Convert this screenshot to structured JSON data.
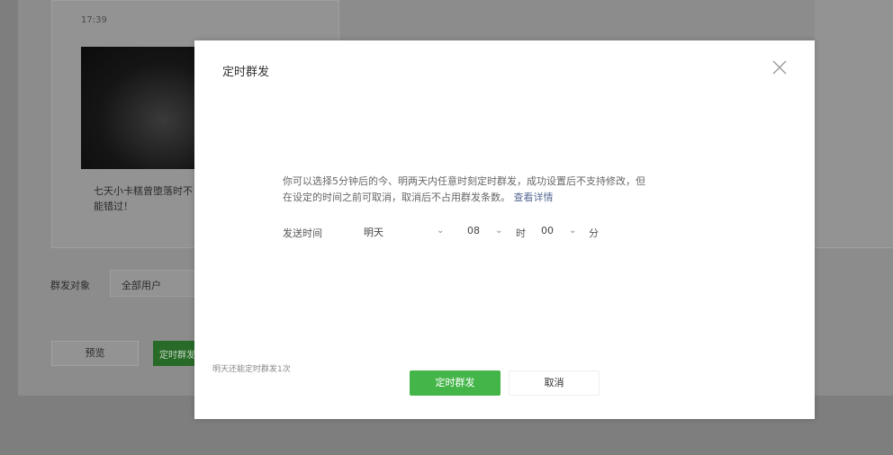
{
  "background": {
    "card_time": "17:39",
    "card_title": "七天小卡糕曾堕落时不能错过！",
    "target_label": "群发对象",
    "target_value": "全部用户",
    "preview_label": "预览",
    "schedule_label": "定时群发"
  },
  "dialog": {
    "title": "定时群发",
    "description_line1": "你可以选择5分钟后的今、明两天内任意时刻定时群发，成功设置后不支持修改，但",
    "description_line2": "在设定的时间之前可取消，取消后不占用群发条数。",
    "detail_link": "查看详情",
    "send_time_label": "发送时间",
    "day_value": "明天",
    "hour_value": "08",
    "hour_unit": "时",
    "minute_value": "00",
    "minute_unit": "分",
    "caret": "⌄",
    "remaining_text": "明天还能定时群发1次",
    "confirm_label": "定时群发",
    "cancel_label": "取消"
  },
  "colors": {
    "primary_green": "#44b549",
    "link_blue": "#576b95"
  }
}
